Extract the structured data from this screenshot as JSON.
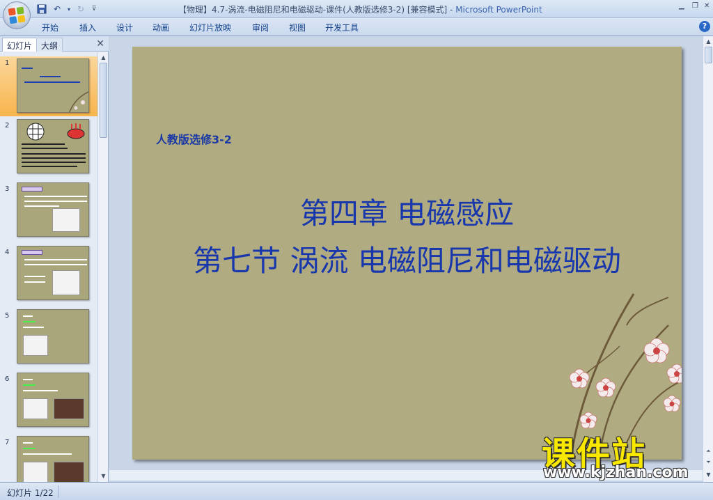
{
  "window": {
    "title_prefix": "【物理】4.7-涡流-电磁阻尼和电磁驱动-课件(人教版选修3-2) [兼容模式] - ",
    "app_name": "Microsoft PowerPoint"
  },
  "quick_access": {
    "icons": [
      "save-icon",
      "undo-icon",
      "redo-icon",
      "customize-icon"
    ]
  },
  "ribbon": {
    "tabs": [
      "开始",
      "插入",
      "设计",
      "动画",
      "幻灯片放映",
      "审阅",
      "视图",
      "开发工具"
    ],
    "help_label": "?"
  },
  "left_pane": {
    "tab_slides": "幻灯片",
    "tab_outline": "大纲",
    "close_label": "✕",
    "thumb_numbers": [
      "1",
      "2",
      "3",
      "4",
      "5",
      "6",
      "7"
    ],
    "selected_index": 0
  },
  "slide": {
    "subtitle": "人教版选修3-2",
    "heading1": "第四章  电磁感应",
    "heading2": "第七节  涡流  电磁阻尼和电磁驱动"
  },
  "statusbar": {
    "text": "幻灯片 1/22"
  },
  "watermark": {
    "brand": "课件站",
    "url": "www.kjzhan.com"
  },
  "colors": {
    "slide_bg": "#b0ab80",
    "title_blue": "#1937ad",
    "accent_selection": "#f8b44d",
    "watermark_yellow": "#f8e800"
  }
}
